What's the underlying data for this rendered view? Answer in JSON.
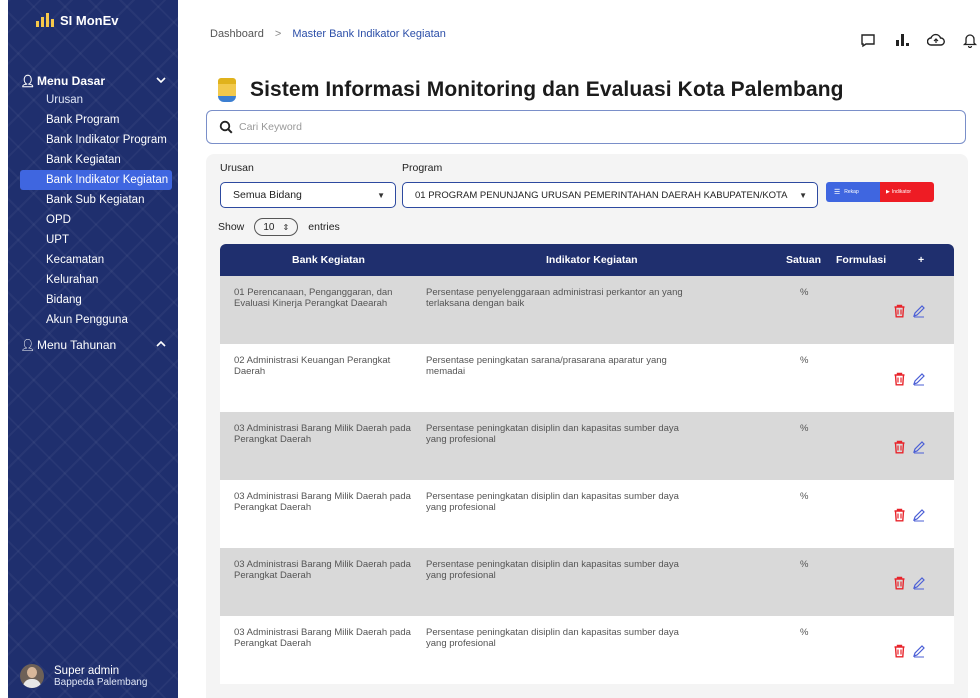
{
  "app": {
    "brand": "SI MonEv",
    "colors": {
      "sidebar": "#1f2f6e",
      "accent": "#3f66e0",
      "danger": "#ee1c24",
      "header": "#1f2f6e"
    }
  },
  "sidebar": {
    "menu_dasar": {
      "label": "Menu Dasar",
      "items": [
        {
          "label": "Urusan",
          "active": false
        },
        {
          "label": "Bank Program",
          "active": false
        },
        {
          "label": "Bank Indikator Program",
          "active": false
        },
        {
          "label": "Bank Kegiatan",
          "active": false
        },
        {
          "label": "Bank Indikator Kegiatan",
          "active": true
        },
        {
          "label": "Bank Sub Kegiatan",
          "active": false
        },
        {
          "label": "OPD",
          "active": false
        },
        {
          "label": "UPT",
          "active": false
        },
        {
          "label": "Kecamatan",
          "active": false
        },
        {
          "label": "Kelurahan",
          "active": false
        },
        {
          "label": "Bidang",
          "active": false
        },
        {
          "label": "Akun Pengguna",
          "active": false
        }
      ]
    },
    "menu_tahunan": {
      "label": "Menu Tahunan"
    },
    "user": {
      "name": "Super admin",
      "org": "Bappeda Palembang"
    }
  },
  "header": {
    "breadcrumb": {
      "root": "Dashboard",
      "separator": ">",
      "current": "Master Bank Indikator Kegiatan"
    },
    "icons": [
      "chat-icon",
      "chart-icon",
      "cloud-icon",
      "bell-icon"
    ]
  },
  "main": {
    "title": "Sistem Informasi Monitoring dan Evaluasi Kota Palembang",
    "search": {
      "placeholder": "Cari Keyword",
      "value": ""
    },
    "filters": {
      "urusan_label": "Urusan",
      "urusan_value": "Semua Bidang",
      "program_label": "Program",
      "program_value": "01 PROGRAM PENUNJANG URUSAN PEMERINTAHAN DAERAH KABUPATEN/KOTA"
    },
    "buttons": {
      "rekap": "Rekap",
      "indikator": "Indikator"
    },
    "entries": {
      "show": "Show",
      "value": "10",
      "suffix": "entries"
    },
    "table": {
      "columns": [
        "Bank Kegiatan",
        "Indikator Kegiatan",
        "Satuan",
        "Formulasi",
        "+"
      ],
      "rows": [
        {
          "kegiatan": "01 Perencanaan, Penganggaran, dan Evaluasi Kinerja Perangkat Daearah",
          "indikator": "Persentase penyelenggaraan administrasi perkantor an yang terlaksana dengan baik",
          "satuan": "%"
        },
        {
          "kegiatan": "02 Administrasi Keuangan Perangkat Daerah",
          "indikator": "Persentase peningkatan sarana/prasarana aparatur yang memadai",
          "satuan": "%"
        },
        {
          "kegiatan": "03 Administrasi Barang Milik Daerah pada Perangkat Daerah",
          "indikator": "Persentase peningkatan disiplin dan kapasitas sumber daya yang profesional",
          "satuan": "%"
        },
        {
          "kegiatan": "03 Administrasi Barang Milik Daerah pada Perangkat Daerah",
          "indikator": "Persentase peningkatan disiplin dan kapasitas sumber daya yang profesional",
          "satuan": "%"
        },
        {
          "kegiatan": "03 Administrasi Barang Milik Daerah pada Perangkat Daerah",
          "indikator": "Persentase peningkatan disiplin dan kapasitas sumber daya yang profesional",
          "satuan": "%"
        },
        {
          "kegiatan": "03 Administrasi Barang Milik Daerah pada Perangkat Daerah",
          "indikator": "Persentase peningkatan disiplin dan kapasitas sumber daya yang profesional",
          "satuan": "%"
        }
      ]
    }
  }
}
